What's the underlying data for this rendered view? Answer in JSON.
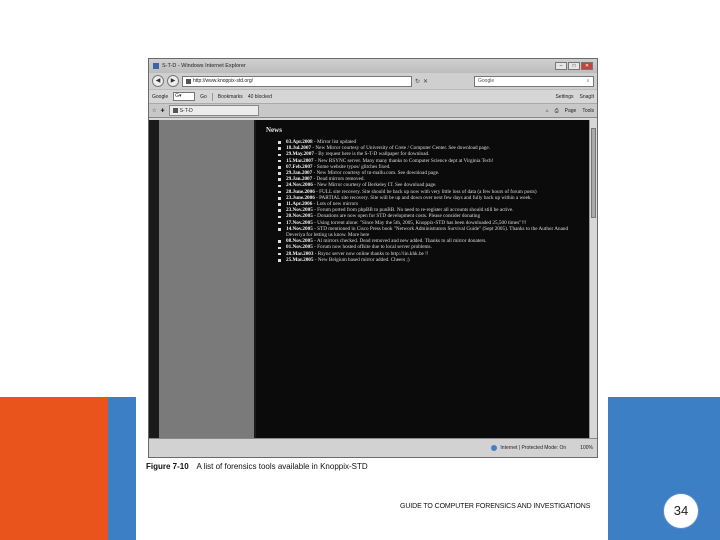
{
  "window": {
    "title": "S-T-D - Windows Internet Explorer",
    "address": "http://www.knoppix-std.org/",
    "search_placeholder": "Google",
    "close_symbol": "✕",
    "min_symbol": "–",
    "max_symbol": "□"
  },
  "google_bar": {
    "logo": "Google",
    "go_label": "Go",
    "bookmarks": "Bookmarks",
    "blocked": "40 blocked",
    "settings": "Settings",
    "snagit": "SnagIt"
  },
  "tab": {
    "label": "S-T-D",
    "page_label": "Page",
    "tools_label": "Tools"
  },
  "news": {
    "title": "News",
    "items": [
      {
        "date": "03.Apr.2008",
        "text": " - Mirror list updated"
      },
      {
        "date": "18.Jul.2007",
        "text": " - New Mirror courtesy of University of Crete / Computer Center. See download page."
      },
      {
        "date": "29.May.2007",
        "text": " - By request here is the S-T-D wallpaper for download."
      },
      {
        "date": "15.Mar.2007",
        "text": " - New RSYNC server. Many many thanks to Computer Science dept at Virginia Tech!"
      },
      {
        "date": "07.Feb.2007",
        "text": " - Some website typos/ glitches fixed."
      },
      {
        "date": "29.Jan.2007",
        "text": " - New Mirror courtesy of tn-mallu.com. See download page."
      },
      {
        "date": "29.Jan.2007",
        "text": " - Dead mirrors removed."
      },
      {
        "date": "24.Nov.2006",
        "text": " - New Mirror courtesy of Berkeley IT. See download page."
      },
      {
        "date": "28.June.2006",
        "text": " - FULL site recovery. Site should be back up now with very little loss of data (a few hours of forum posts)"
      },
      {
        "date": "23.June.2006",
        "text": " - PARTIAL site recovery. Site will be up and down over next few days and fully back up within a week."
      },
      {
        "date": "11.Apr.2006",
        "text": " - Lots of new mirrors"
      },
      {
        "date": "23.Nov.2005",
        "text": " - Forum ported from phpBB to punBB. No need to re-register all accounts should still be active."
      },
      {
        "date": "20.Nov.2005",
        "text": " - Donations are now open for STD development costs. Please consider donating"
      },
      {
        "date": "17.Nov.2005",
        "text": " - Using torrent alone: \"Since May the 5th, 2005, Knoppix-STD has been downloaded 25,500 times\"!!!"
      },
      {
        "date": "14.Nov.2005",
        "text": " - STD mentioned in Cisco Press book \"Network Administrators Survival Guide\" (Sept 2005). Thanks to the Author Anand Deveriya for letting us know. More here"
      },
      {
        "date": "08.Nov.2005",
        "text": " - Al mirrors checked. Dead removed and new added. Thanks to all mirror donaters."
      },
      {
        "date": "01.Nov.2005",
        "text": " - Forum now hosted offsite due to local server problems."
      },
      {
        "date": "28.Mar.2003",
        "text": " - Rsync server now online thanks to http://iin.khk.be !!"
      },
      {
        "date": "25.Mar.2005",
        "text": " - New Belgium based mirror added. Cheers ;)"
      }
    ]
  },
  "status": {
    "zone": "Internet | Protected Mode: On",
    "zoom": "100%"
  },
  "caption": {
    "label": "Figure 7-10",
    "text": "A list of forensics tools available in Knoppix-STD"
  },
  "footer": {
    "text": "GUIDE TO COMPUTER FORENSICS AND INVESTIGATIONS",
    "page": "34"
  },
  "colors": {
    "orange": "#e8541b",
    "blue": "#3d7fc4"
  }
}
